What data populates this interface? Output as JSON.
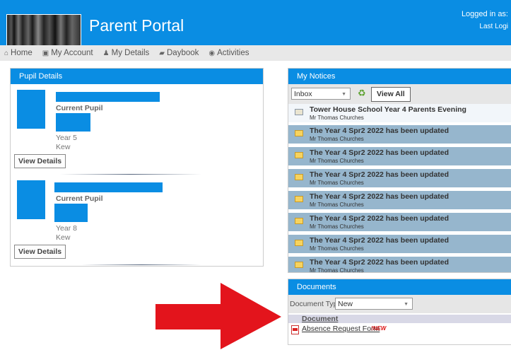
{
  "header": {
    "title": "Parent Portal",
    "logged_in_label": "Logged in as:",
    "last_login_label": "Last Logi"
  },
  "nav": {
    "items": [
      {
        "icon": "home-icon",
        "glyph": "⌂",
        "label": "Home"
      },
      {
        "icon": "account-card-icon",
        "glyph": "▣",
        "label": "My Account"
      },
      {
        "icon": "user-icon",
        "glyph": "♟",
        "label": "My Details"
      },
      {
        "icon": "book-icon",
        "glyph": "▰",
        "label": "Daybook"
      },
      {
        "icon": "activities-icon",
        "glyph": "◉",
        "label": "Activities"
      }
    ]
  },
  "pupil_panel": {
    "title": "Pupil Details",
    "pupils": [
      {
        "status": "Current Pupil",
        "year": "Year 5",
        "location": "Kew",
        "button": "View Details"
      },
      {
        "status": "Current Pupil",
        "year": "Year 8",
        "location": "Kew",
        "button": "View Details"
      }
    ]
  },
  "notices_panel": {
    "title": "My Notices",
    "folder_selected": "Inbox",
    "view_all_label": "View All",
    "notices": [
      {
        "subject": "Tower House School Year 4 Parents Evening",
        "from": "Mr Thomas Churches",
        "num": "1",
        "read": true
      },
      {
        "subject": "The Year 4 Spr2 2022 has been updated",
        "from": "Mr Thomas Churches",
        "num": "1",
        "read": false
      },
      {
        "subject": "The Year 4 Spr2 2022 has been updated",
        "from": "Mr Thomas Churches",
        "num": "1",
        "read": false
      },
      {
        "subject": "The Year 4 Spr2 2022 has been updated",
        "from": "Mr Thomas Churches",
        "num": "1",
        "read": false
      },
      {
        "subject": "The Year 4 Spr2 2022 has been updated",
        "from": "Mr Thomas Churches",
        "num": "1",
        "read": false
      },
      {
        "subject": "The Year 4 Spr2 2022 has been updated",
        "from": "Mr Thomas Churches",
        "num": "1",
        "read": false
      },
      {
        "subject": "The Year 4 Spr2 2022 has been updated",
        "from": "Mr Thomas Churches",
        "num": "1",
        "read": false
      },
      {
        "subject": "The Year 4 Spr2 2022 has been updated",
        "from": "Mr Thomas Churches",
        "num": "1",
        "read": false
      }
    ]
  },
  "documents_panel": {
    "title": "Documents",
    "type_label": "Document Type:",
    "type_selected": "New",
    "column_header": "Document",
    "rows": [
      {
        "name": "Absence Request Form",
        "badge": "!NEW"
      }
    ]
  },
  "colors": {
    "brand_blue": "#0a8de3",
    "unread_row": "#96b6cd",
    "arrow_red": "#e3141c"
  }
}
